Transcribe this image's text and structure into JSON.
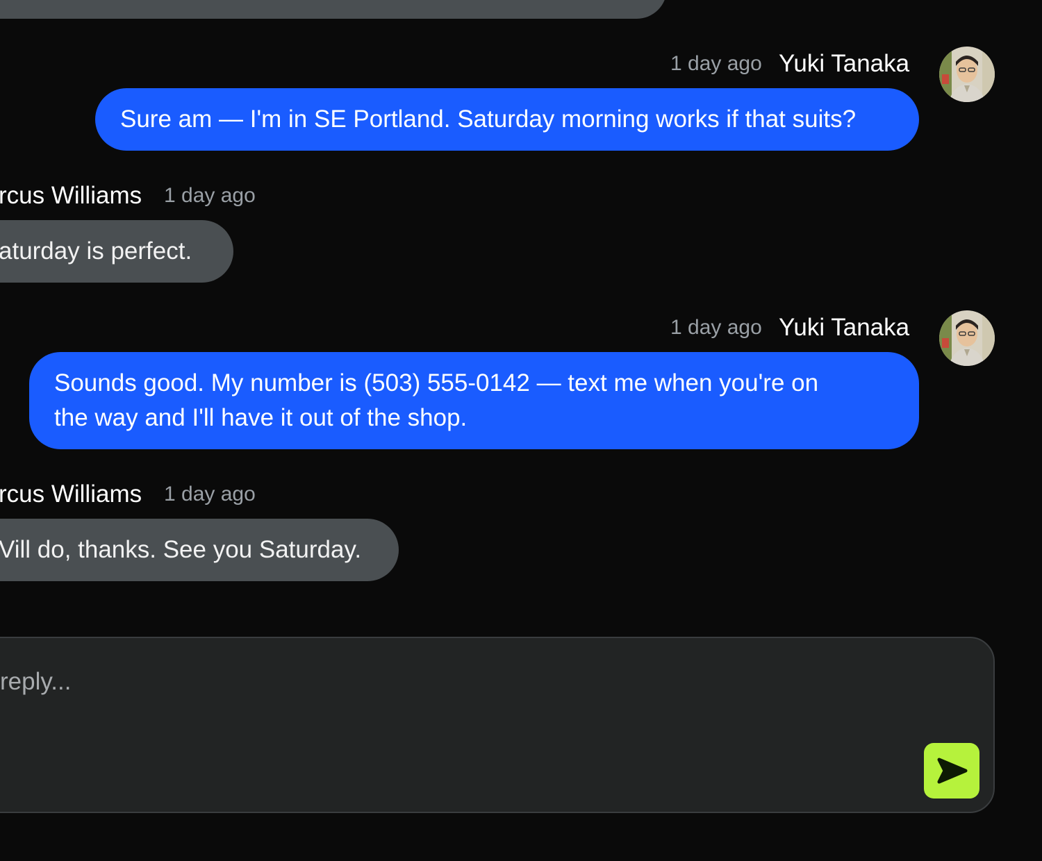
{
  "messages": [
    {
      "sender": "Yuki Tanaka",
      "time": "1 day ago",
      "text": "Sure am — I'm in SE Portland. Saturday morning works if that suits?"
    },
    {
      "sender": "rcus Williams",
      "time": "1 day ago",
      "text": "aturday is perfect."
    },
    {
      "sender": "Yuki Tanaka",
      "time": "1 day ago",
      "text_line1": "Sounds good. My number is (503) 555-0142 — text me when you're on",
      "text_line2": "the way and I'll have it out of the shop."
    },
    {
      "sender": "rcus Williams",
      "time": "1 day ago",
      "text": "Vill do, thanks. See you Saturday."
    }
  ],
  "composer": {
    "placeholder": "reply..."
  },
  "colors": {
    "background": "#0a0a0a",
    "other_bubble": "#4a4f52",
    "mine_bubble": "#1a5cff",
    "send_button": "#b6f23c"
  },
  "icons": {
    "send": "send-arrow-icon",
    "avatar": "user-avatar"
  }
}
